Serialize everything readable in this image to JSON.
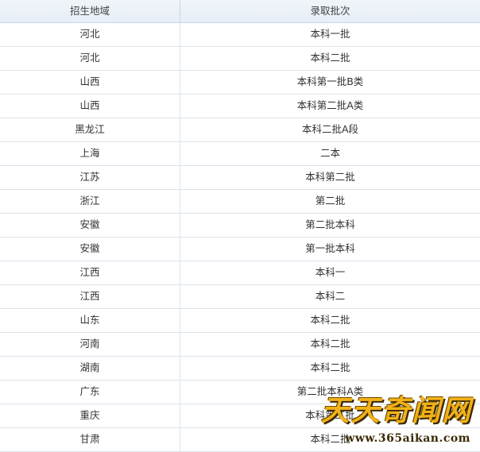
{
  "table": {
    "headers": {
      "province": "招生地域",
      "batch": "录取批次"
    },
    "rows": [
      {
        "province": "河北",
        "batch": "本科一批"
      },
      {
        "province": "河北",
        "batch": "本科二批"
      },
      {
        "province": "山西",
        "batch": "本科第一批B类"
      },
      {
        "province": "山西",
        "batch": "本科第二批A类"
      },
      {
        "province": "黑龙江",
        "batch": "本科二批A段"
      },
      {
        "province": "上海",
        "batch": "二本"
      },
      {
        "province": "江苏",
        "batch": "本科第二批"
      },
      {
        "province": "浙江",
        "batch": "第二批"
      },
      {
        "province": "安徽",
        "batch": "第二批本科"
      },
      {
        "province": "安徽",
        "batch": "第一批本科"
      },
      {
        "province": "江西",
        "batch": "本科一"
      },
      {
        "province": "江西",
        "batch": "本科二"
      },
      {
        "province": "山东",
        "batch": "本科二批"
      },
      {
        "province": "河南",
        "batch": "本科二批"
      },
      {
        "province": "湖南",
        "batch": "本科二批"
      },
      {
        "province": "广东",
        "batch": "第二批本科A类"
      },
      {
        "province": "重庆",
        "batch": "本科第二批"
      },
      {
        "province": "甘肃",
        "batch": "本科二批"
      }
    ]
  },
  "watermark": {
    "title": "天天奇闻网",
    "url": "www.365aikan.com"
  }
}
